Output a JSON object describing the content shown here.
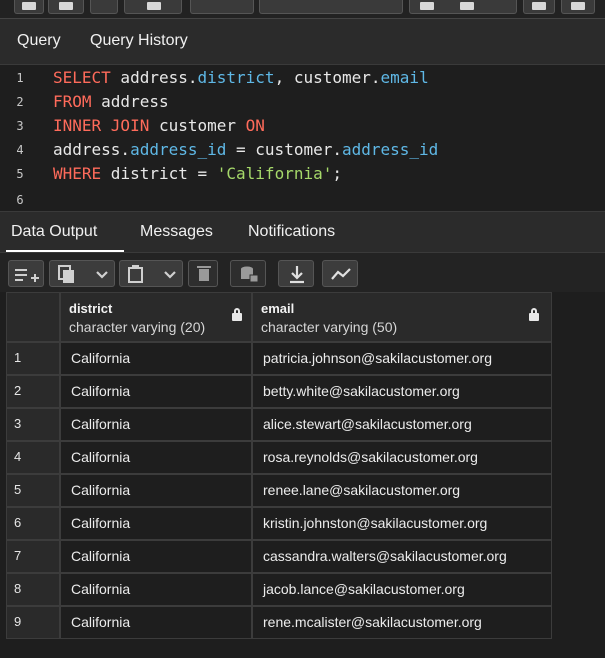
{
  "query_tabs": [
    "Query",
    "Query History"
  ],
  "editor": {
    "lines": [
      {
        "n": "1"
      },
      {
        "n": "2"
      },
      {
        "n": "3"
      },
      {
        "n": "4"
      },
      {
        "n": "5"
      },
      {
        "n": "6"
      }
    ],
    "tokens": {
      "l1_kw": "SELECT",
      "l1_a": " address.",
      "l1_f1": "district",
      "l1_b": ", customer.",
      "l1_f2": "email",
      "l2_kw": "FROM",
      "l2_a": " address",
      "l3_kw": "INNER JOIN",
      "l3_a": " customer ",
      "l3_kw2": "ON",
      "l4_a": "address.",
      "l4_f1": "address_id",
      "l4_b": " = customer.",
      "l4_f2": "address_id",
      "l5_kw": "WHERE",
      "l5_a": " district = ",
      "l5_str": "'California'",
      "l5_b": ";"
    }
  },
  "result_tabs": [
    "Data Output",
    "Messages",
    "Notifications"
  ],
  "toolbar_icons": [
    "add-row-icon",
    "copy-icon",
    "chevron-down-icon",
    "paste-icon",
    "chevron-down-icon",
    "delete-icon",
    "save-data-icon",
    "download-icon",
    "graph-icon"
  ],
  "table": {
    "columns": [
      {
        "name": "district",
        "type": "character varying (20)"
      },
      {
        "name": "email",
        "type": "character varying (50)"
      }
    ],
    "rows": [
      {
        "n": "1",
        "district": "California",
        "email": "patricia.johnson@sakilacustomer.org"
      },
      {
        "n": "2",
        "district": "California",
        "email": "betty.white@sakilacustomer.org"
      },
      {
        "n": "3",
        "district": "California",
        "email": "alice.stewart@sakilacustomer.org"
      },
      {
        "n": "4",
        "district": "California",
        "email": "rosa.reynolds@sakilacustomer.org"
      },
      {
        "n": "5",
        "district": "California",
        "email": "renee.lane@sakilacustomer.org"
      },
      {
        "n": "6",
        "district": "California",
        "email": "kristin.johnston@sakilacustomer.org"
      },
      {
        "n": "7",
        "district": "California",
        "email": "cassandra.walters@sakilacustomer.org"
      },
      {
        "n": "8",
        "district": "California",
        "email": "jacob.lance@sakilacustomer.org"
      },
      {
        "n": "9",
        "district": "California",
        "email": "rene.mcalister@sakilacustomer.org"
      }
    ]
  },
  "colors": {
    "keyword": "#ff6b5b",
    "field": "#5fb8e6",
    "string": "#a6d96a",
    "background": "#1e1e1e"
  }
}
